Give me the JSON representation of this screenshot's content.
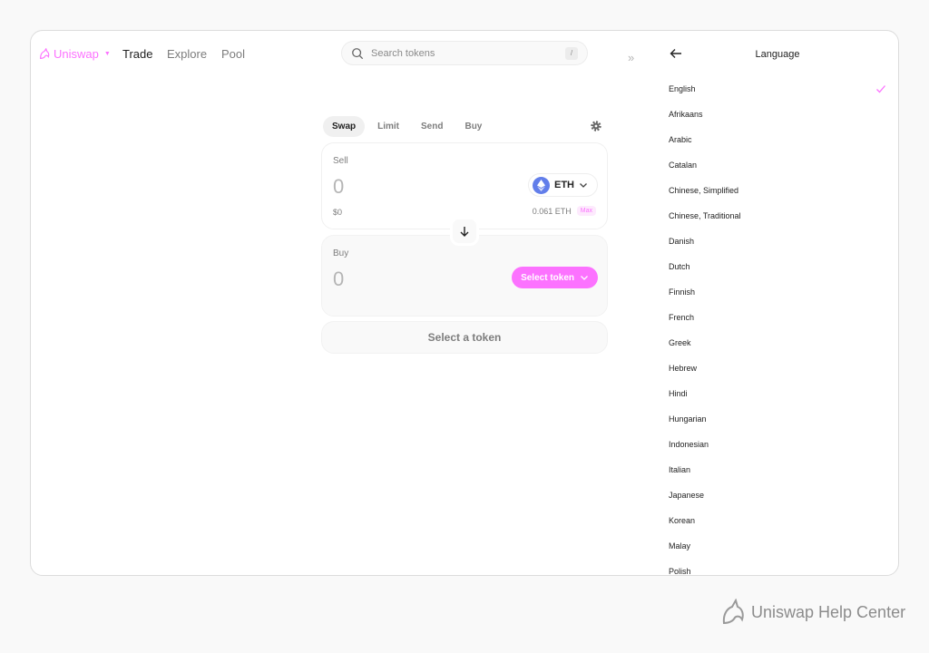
{
  "nav": {
    "brand": "Uniswap",
    "links": [
      "Trade",
      "Explore",
      "Pool"
    ],
    "search_placeholder": "Search tokens",
    "search_shortcut": "/"
  },
  "swap": {
    "tabs": [
      "Swap",
      "Limit",
      "Send",
      "Buy"
    ],
    "sell": {
      "label": "Sell",
      "amount": "0",
      "usd": "$0",
      "token": "ETH",
      "balance": "0.061 ETH",
      "max_label": "Max"
    },
    "buy": {
      "label": "Buy",
      "amount": "0",
      "select_label": "Select token"
    },
    "cta_label": "Select a token"
  },
  "drawer": {
    "title": "Language",
    "languages": [
      "English",
      "Afrikaans",
      "Arabic",
      "Catalan",
      "Chinese, Simplified",
      "Chinese, Traditional",
      "Danish",
      "Dutch",
      "Finnish",
      "French",
      "Greek",
      "Hebrew",
      "Hindi",
      "Hungarian",
      "Indonesian",
      "Italian",
      "Japanese",
      "Korean",
      "Malay",
      "Polish"
    ],
    "selected": "English"
  },
  "footer": {
    "help_label": "Uniswap Help Center"
  },
  "colors": {
    "accent": "#fc72ff",
    "eth": "#627eea"
  }
}
